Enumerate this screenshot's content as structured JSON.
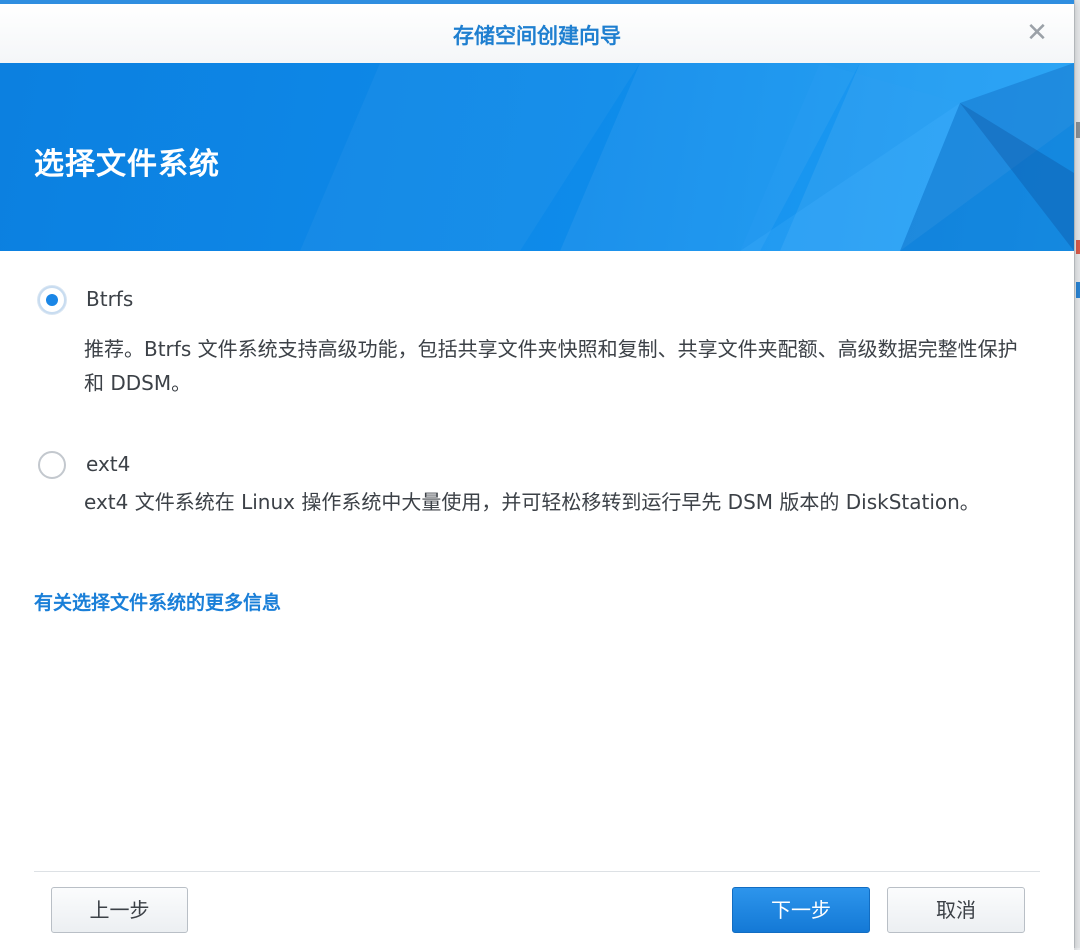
{
  "window": {
    "title": "存储空间创建向导",
    "close_icon": "close-icon"
  },
  "banner": {
    "heading": "选择文件系统"
  },
  "options": [
    {
      "label": "Btrfs",
      "selected": true,
      "description": "推荐。Btrfs 文件系统支持高级功能，包括共享文件夹快照和复制、共享文件夹配额、高级数据完整性保护和 DDSM。"
    },
    {
      "label": "ext4",
      "selected": false,
      "description": "ext4 文件系统在 Linux 操作系统中大量使用，并可轻松移转到运行早先 DSM 版本的 DiskStation。"
    }
  ],
  "more_info_link": "有关选择文件系统的更多信息",
  "footer": {
    "back_label": "上一步",
    "next_label": "下一步",
    "cancel_label": "取消"
  },
  "colors": {
    "accent": "#1a86e6",
    "banner": "#0e8bea",
    "title_text": "#1f7fd0",
    "body_text": "#3c4147"
  }
}
